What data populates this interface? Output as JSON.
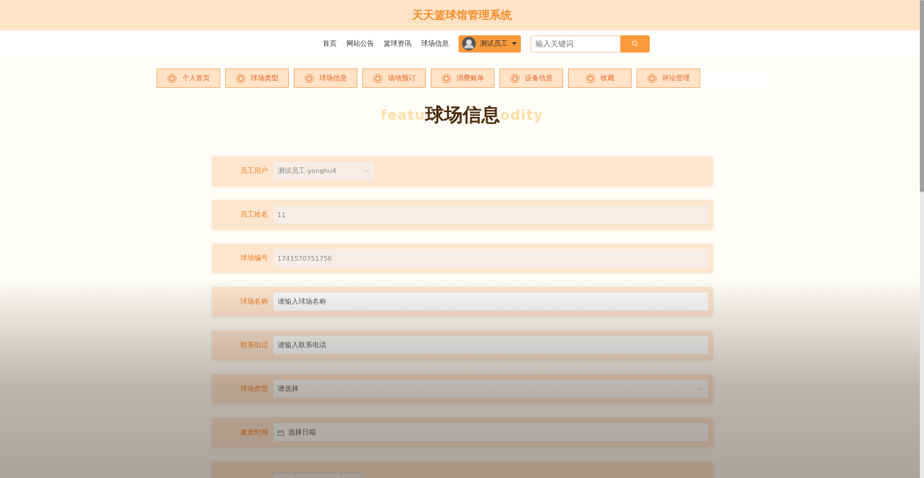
{
  "header": {
    "title": "天天篮球馆管理系统"
  },
  "nav": {
    "links": [
      {
        "label": "首页"
      },
      {
        "label": "网站公告"
      },
      {
        "label": "篮球资讯"
      },
      {
        "label": "球场信息"
      }
    ],
    "user": {
      "name": "测试员工"
    },
    "search": {
      "placeholder": "输入关键词"
    }
  },
  "tabs": [
    {
      "label": "个人首页"
    },
    {
      "label": "球场类型"
    },
    {
      "label": "球场信息"
    },
    {
      "label": "场地预订"
    },
    {
      "label": "消费账单"
    },
    {
      "label": "设备信息"
    },
    {
      "label": "收藏"
    },
    {
      "label": "评论管理"
    }
  ],
  "page": {
    "title": "球场信息",
    "backdrop_left": "featu",
    "backdrop_right": "odity"
  },
  "form": [
    {
      "label": "员工用户",
      "kind": "select_short",
      "value": "测试员工-yonghu4",
      "disabled": true
    },
    {
      "label": "员工姓名",
      "kind": "text",
      "value": "11",
      "disabled": true
    },
    {
      "label": "球场编号",
      "kind": "text",
      "value": "1741570751756",
      "disabled": true
    },
    {
      "label": "球场名称",
      "kind": "text",
      "placeholder": "请输入球场名称",
      "disabled": false
    },
    {
      "label": "联系电话",
      "kind": "text",
      "placeholder": "请输入联系电话",
      "disabled": false
    },
    {
      "label": "球场类型",
      "kind": "select",
      "placeholder": "请选择",
      "disabled": false
    },
    {
      "label": "建造时间",
      "kind": "date",
      "placeholder": "选择日期",
      "disabled": false
    },
    {
      "kind": "number"
    }
  ]
}
